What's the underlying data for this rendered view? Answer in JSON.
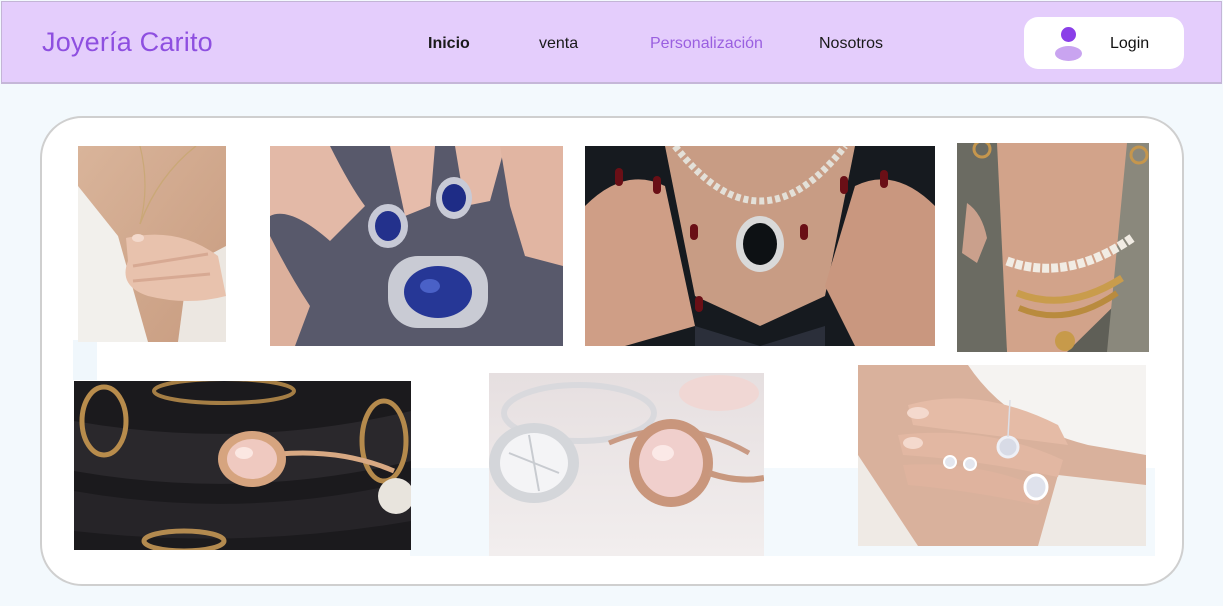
{
  "header": {
    "brand": "Joyería Carito",
    "nav": [
      {
        "label": "Inicio",
        "active": true
      },
      {
        "label": "venta"
      },
      {
        "label": "Personalización",
        "highlight": true
      },
      {
        "label": "Nosotros"
      }
    ],
    "login_label": "Login"
  },
  "colors": {
    "header_bg": "#e4cdfc",
    "brand": "#8e4fe0",
    "nav_highlight": "#9a5fe0",
    "page_bg": "#f3f9fd"
  },
  "gallery": {
    "photos": [
      {
        "subject": "woman-with-diamond-pendant-necklace"
      },
      {
        "subject": "hands-holding-sapphire-diamond-jewelry"
      },
      {
        "subject": "hands-framing-black-diamond-necklace"
      },
      {
        "subject": "pearl-and-gold-chain-necklaces"
      },
      {
        "subject": "morganite-halo-engagement-ring"
      },
      {
        "subject": "diamond-and-morganite-rings"
      },
      {
        "subject": "hand-with-diamond-rings-and-earrings"
      }
    ]
  }
}
